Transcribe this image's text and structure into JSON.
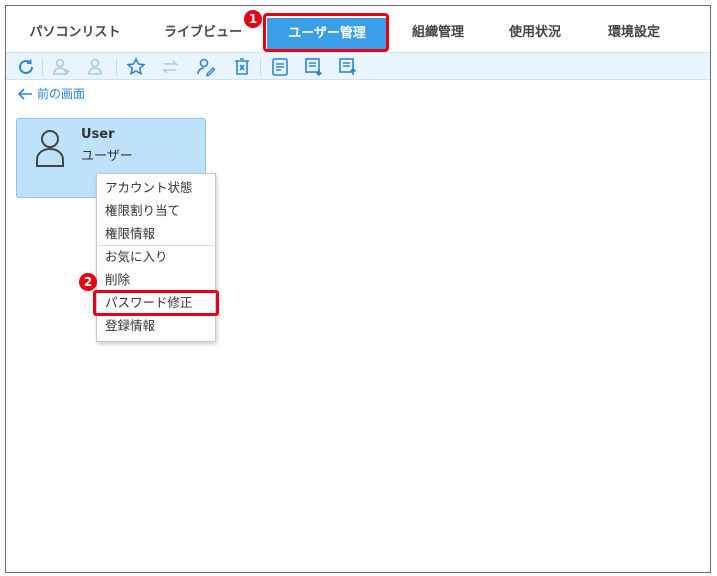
{
  "tabs": [
    {
      "label": "パソコンリスト"
    },
    {
      "label": "ライブビュー"
    },
    {
      "label": "ユーザー管理"
    },
    {
      "label": "組織管理"
    },
    {
      "label": "使用状況"
    },
    {
      "label": "環境設定"
    }
  ],
  "active_tab": "ユーザー管理",
  "toolbar": {
    "icons": [
      "refresh-icon",
      "add-user-icon",
      "add-user-alt-icon",
      "favorite-star-icon",
      "swap-icon",
      "edit-user-icon",
      "delete-icon",
      "list-icon",
      "export-icon",
      "import-icon"
    ]
  },
  "back": {
    "label": "前の画面"
  },
  "card": {
    "name": "User",
    "role": "ユーザー"
  },
  "menu": {
    "items": [
      {
        "label": "アカウント状態"
      },
      {
        "label": "権限割り当て"
      },
      {
        "label": "権限情報"
      },
      {
        "label": "お気に入り"
      },
      {
        "label": "削除"
      },
      {
        "label": "パスワード修正"
      },
      {
        "label": "登録情報"
      }
    ]
  },
  "markers": {
    "step1": "1",
    "step2": "2"
  },
  "colors": {
    "accent": "#3a9ee8",
    "highlight": "#e60012",
    "card": "#bfe2fb",
    "link": "#2b86d6"
  }
}
